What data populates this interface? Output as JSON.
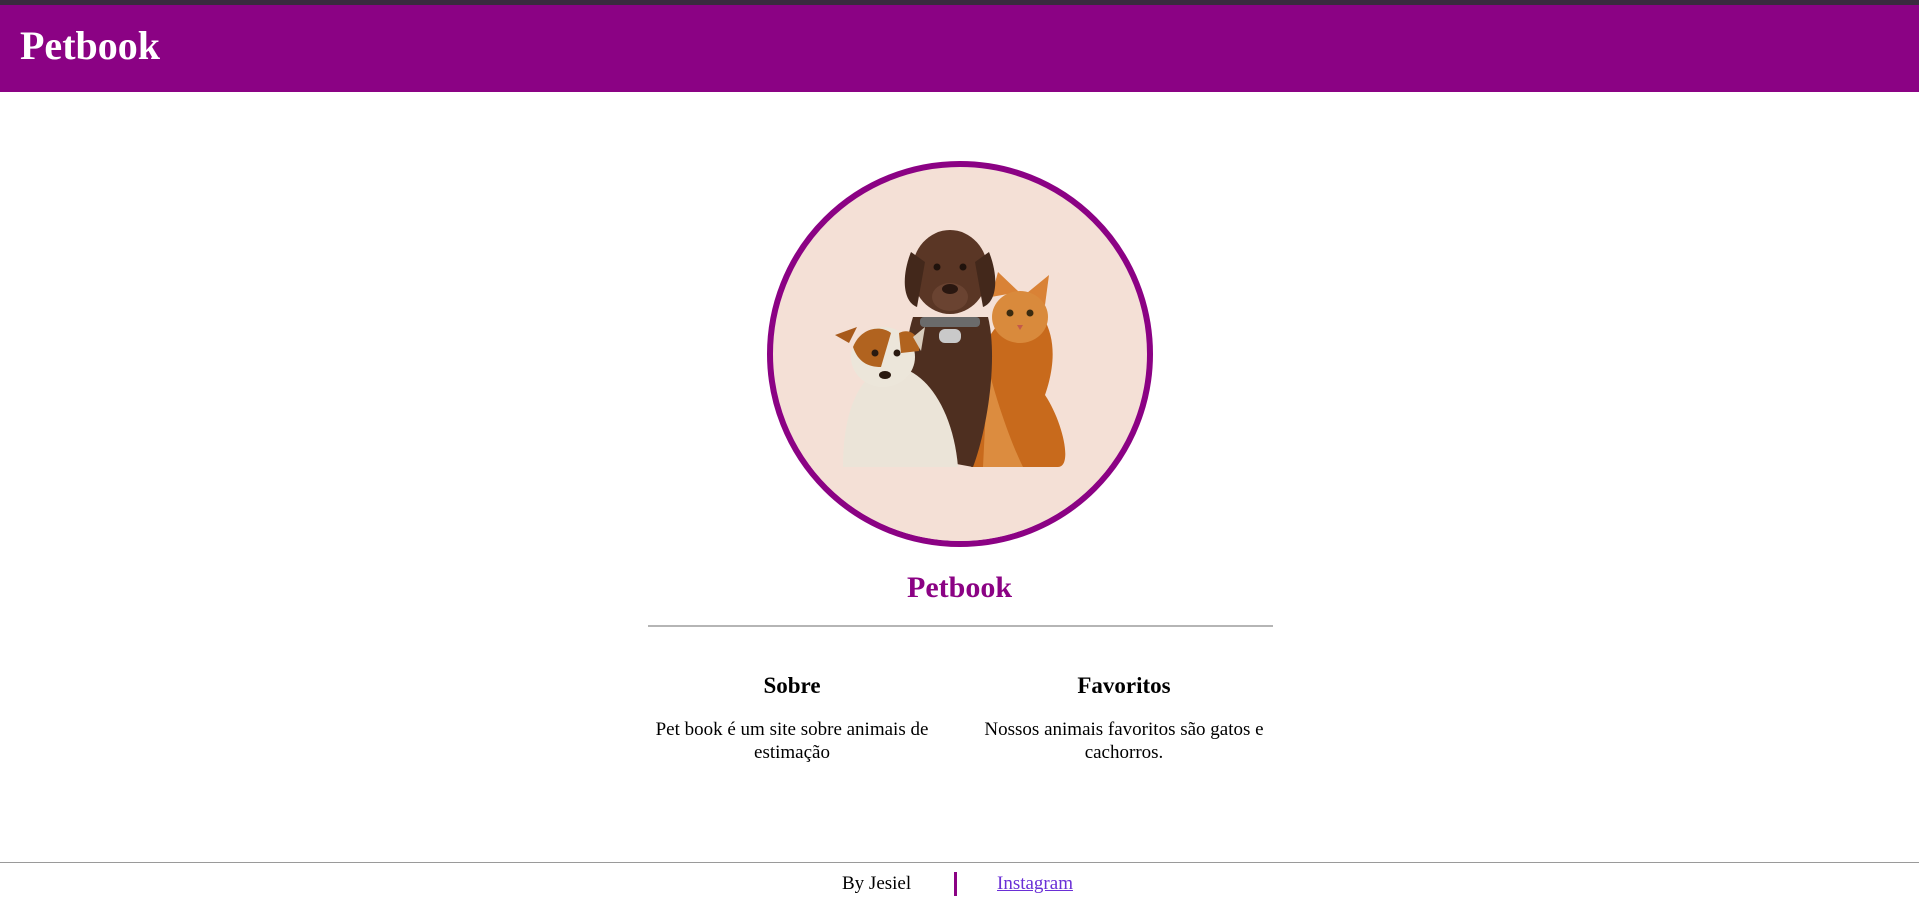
{
  "header": {
    "title": "Petbook"
  },
  "profile": {
    "image_alt": "dogs-and-cat-photo",
    "name": "Petbook"
  },
  "sections": [
    {
      "heading": "Sobre",
      "text": "Pet book é um site sobre animais de estimação"
    },
    {
      "heading": "Favoritos",
      "text": "Nossos animais favoritos são gatos e cachorros."
    }
  ],
  "footer": {
    "author": "By Jesiel",
    "link_label": "Instagram"
  },
  "colors": {
    "brand": "#8b0284",
    "link": "#6a2fd6",
    "avatar_bg": "#f4e0d6"
  }
}
